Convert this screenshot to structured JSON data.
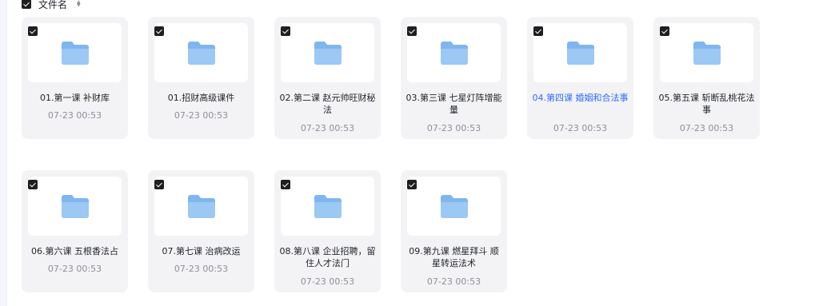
{
  "header": {
    "label": "文件名",
    "sort_icon": "sort-icon"
  },
  "folder_icon_color": "#7fb6ef",
  "selected_color": "#2f6bff",
  "items": [
    {
      "name": "01.第一课 补财库",
      "date": "07-23 00:53"
    },
    {
      "name": "01.招财高级课件",
      "date": "07-23 00:53"
    },
    {
      "name": "02.第二课 赵元帅旺财秘法",
      "date": "07-23 00:53"
    },
    {
      "name": "03.第三课 七星灯阵增能量",
      "date": "07-23 00:53"
    },
    {
      "name": "04.第四课 婚姻和合法事",
      "date": "07-23 00:53",
      "selected": true
    },
    {
      "name": "05.第五课 斩断乱桃花法事",
      "date": "07-23 00:53"
    },
    {
      "name": "06.第六课 五根香法占",
      "date": "07-23 00:53"
    },
    {
      "name": "07.第七课 治病改运",
      "date": "07-23 00:53"
    },
    {
      "name": "08.第八课 企业招聘，留住人才法门",
      "date": "07-23 00:53"
    },
    {
      "name": "09.第九课 燃星拜斗 顺星转运法术",
      "date": "07-23 00:53"
    }
  ]
}
